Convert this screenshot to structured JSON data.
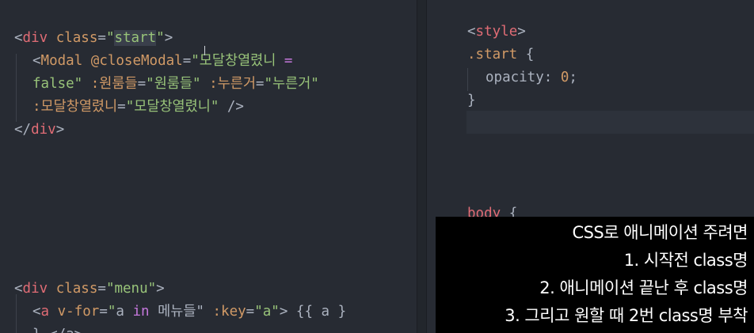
{
  "editor_left": {
    "block1": {
      "line1": {
        "open": "<",
        "tag": "div",
        "sp": " ",
        "attr": "class",
        "eq": "=",
        "q1": "\"",
        "val": "start",
        "q2": "\"",
        "close": ">"
      },
      "line2": {
        "open": "<",
        "tag": "Modal",
        "sp": " ",
        "attr": "@closeModal",
        "eq": "=",
        "str": "\"모달창열렸니 ",
        "kw": "="
      },
      "line3": {
        "str": "false\"",
        "sp1": " ",
        "attr1": ":원룸들",
        "eq1": "=",
        "str1": "\"원룸들\"",
        "sp2": " ",
        "attr2": ":누른거",
        "eq2": "=",
        "str2": "\"누른거\""
      },
      "line4": {
        "attr": ":모달창열렸니",
        "eq": "=",
        "str": "\"모달창열렸니\"",
        "close": " />"
      },
      "line5": {
        "open": "</",
        "tag": "div",
        "close": ">"
      }
    },
    "block2": {
      "line1": {
        "open": "<",
        "tag": "div",
        "sp": " ",
        "attr": "class",
        "eq": "=",
        "str": "\"menu\"",
        "close": ">"
      },
      "line2": {
        "open": "<",
        "tag": "a",
        "sp": " ",
        "attr1": "v-for",
        "eq1": "=",
        "q1": "\"",
        "kwa": "a",
        "kw": " in ",
        "rest": "메뉴들\"",
        "sp2": " ",
        "attr2": ":key",
        "eq2": "=",
        "str2": "\"a\"",
        "close": ">",
        "mustache": " {{ a }"
      },
      "line3": {
        "text": "} </a>"
      }
    }
  },
  "editor_right": {
    "line1": {
      "open": "<",
      "tag": "style",
      "close": ">"
    },
    "line2": {
      "selector": ".start",
      "brace": " {"
    },
    "line3": {
      "prop": "opacity",
      "colon": ": ",
      "num": "0",
      "semi": ";"
    },
    "line4": {
      "brace": "}"
    },
    "line5": {
      "selector": "body",
      "brace": " {"
    }
  },
  "overlay": {
    "lines": [
      "CSS로 애니메이션 주려면",
      "1. 시작전 class명",
      "2. 애니메이션 끝난 후 class명",
      "3. 그리고 원할 때 2번 class명 부착"
    ]
  }
}
